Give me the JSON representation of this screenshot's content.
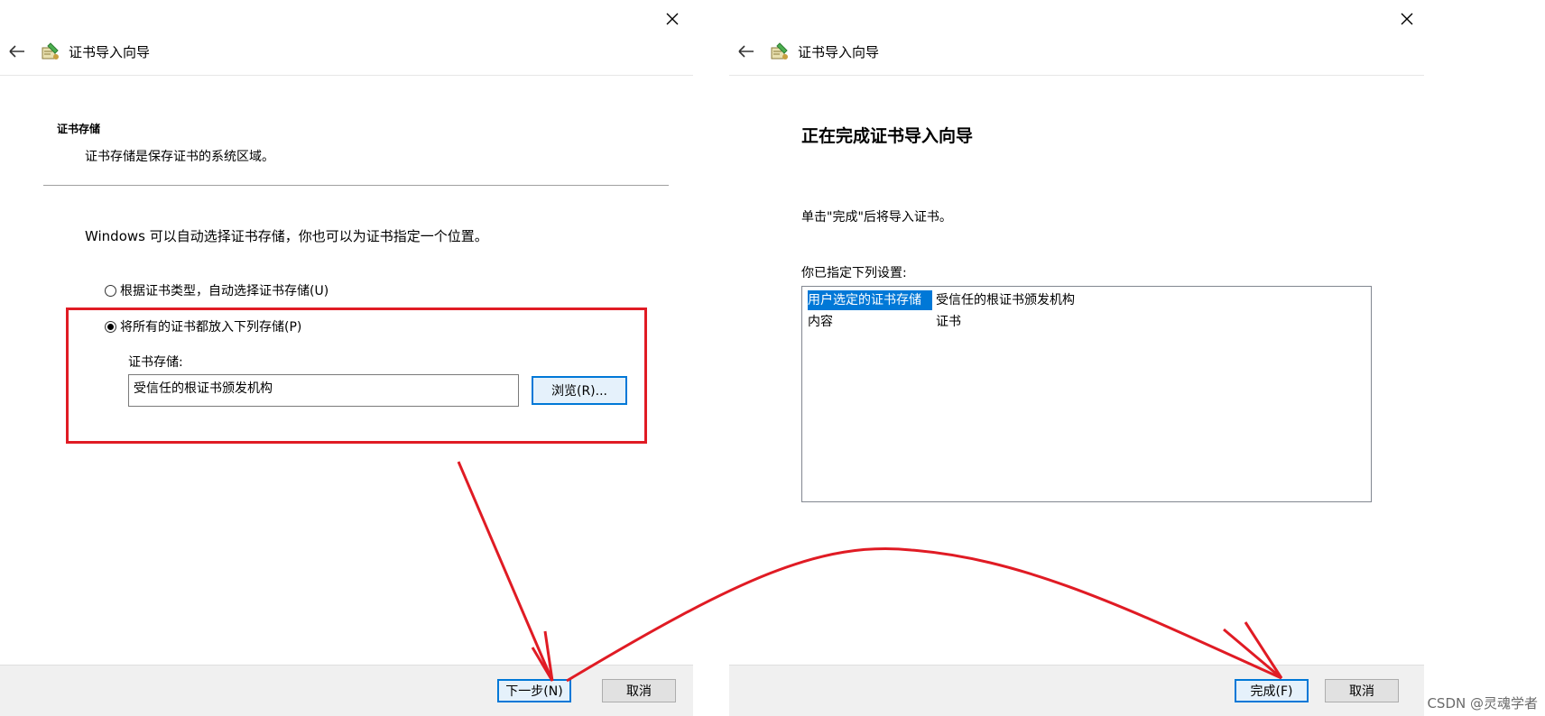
{
  "left_dialog": {
    "title": "证书导入向导",
    "section_title": "证书存储",
    "section_desc": "证书存储是保存证书的系统区域。",
    "intro": "Windows 可以自动选择证书存储，你也可以为证书指定一个位置。",
    "radio_auto_label": "根据证书类型，自动选择证书存储(U)",
    "radio_manual_label": "将所有的证书都放入下列存储(P)",
    "store_label": "证书存储:",
    "store_value": "受信任的根证书颁发机构",
    "browse_label": "浏览(R)...",
    "next_label": "下一步(N)",
    "cancel_label": "取消"
  },
  "right_dialog": {
    "title": "证书导入向导",
    "heading": "正在完成证书导入向导",
    "finish_note": "单击\"完成\"后将导入证书。",
    "settings_label": "你已指定下列设置:",
    "settings": [
      {
        "key": "用户选定的证书存储",
        "value": "受信任的根证书颁发机构"
      },
      {
        "key": "内容",
        "value": "证书"
      }
    ],
    "finish_label": "完成(F)",
    "cancel_label": "取消"
  },
  "watermark": "CSDN @灵魂学者",
  "colors": {
    "annotation": "#e01b24",
    "selection": "#0078d7",
    "footer": "#f0f0f0"
  }
}
